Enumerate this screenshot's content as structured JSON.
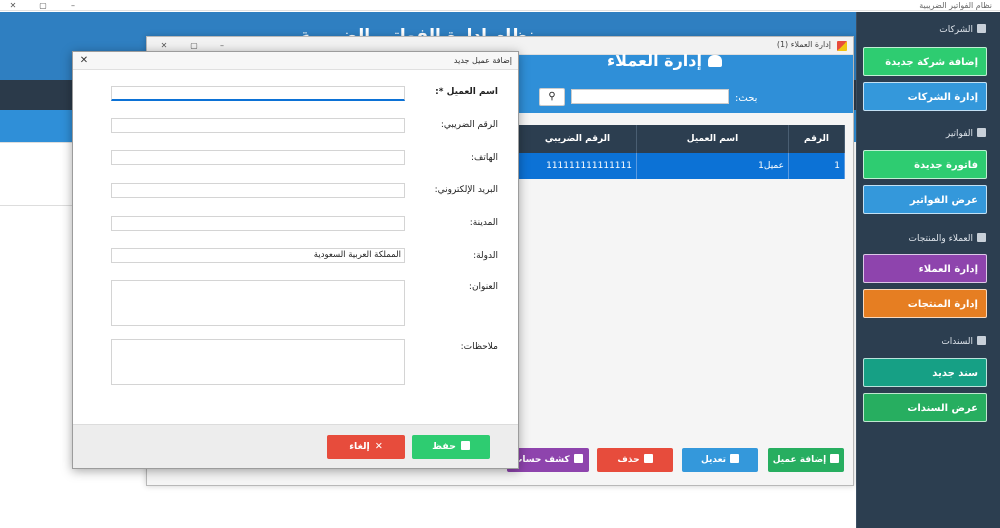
{
  "app": {
    "title": "نظام الفواتير الضريبية",
    "header_title": "نظام إدارة الفواتير الضريبية"
  },
  "sidebar": {
    "sections": [
      {
        "label": "الشركات",
        "icon": "building-icon"
      },
      {
        "label": "الفواتير",
        "icon": "document-icon"
      },
      {
        "label": "العملاء والمنتجات",
        "icon": "users-icon"
      },
      {
        "label": "السندات",
        "icon": "receipt-icon"
      }
    ],
    "buttons": [
      {
        "label": "إضافة شركة جديدة",
        "color": "#2ecc71"
      },
      {
        "label": "إدارة الشركات",
        "color": "#3498db"
      },
      {
        "label": "فاتورة جديدة",
        "color": "#2ecc71"
      },
      {
        "label": "عرض الفواتير",
        "color": "#3498db"
      },
      {
        "label": "إدارة العملاء",
        "color": "#8e44ad"
      },
      {
        "label": "إدارة المنتجات",
        "color": "#e67e22"
      },
      {
        "label": "سند جديد",
        "color": "#16a085"
      },
      {
        "label": "عرض السندات",
        "color": "#27ae60"
      }
    ]
  },
  "customers_window": {
    "title": "إدارة العملاء (1)",
    "header_title": "إدارة العملاء",
    "search_label": "بحث:",
    "search_value": "",
    "table": {
      "columns": [
        "الرقم",
        "اسم العميل",
        "الرقم الضريبي"
      ],
      "rows": [
        [
          "1",
          "عميل1",
          "111111111111111"
        ]
      ]
    },
    "actions": [
      {
        "label": "إضافة عميل",
        "color": "#27ae60"
      },
      {
        "label": "تعديل",
        "color": "#3498db"
      },
      {
        "label": "حذف",
        "color": "#e74c3c"
      },
      {
        "label": "كشف حساب",
        "color": "#8e44ad"
      }
    ]
  },
  "dialog": {
    "title": "إضافة عميل جديد",
    "fields": [
      {
        "label": "اسم العميل *:",
        "value": ""
      },
      {
        "label": "الرقم الضريبي:",
        "value": ""
      },
      {
        "label": "الهاتف:",
        "value": ""
      },
      {
        "label": "البريد الإلكتروني:",
        "value": ""
      },
      {
        "label": "المدينة:",
        "value": ""
      },
      {
        "label": "الدولة:",
        "value": "المملكة العربية السعودية"
      },
      {
        "label": "العنوان:",
        "value": ""
      },
      {
        "label": "ملاحظات:",
        "value": ""
      }
    ],
    "save_label": "حفظ",
    "cancel_label": "إلغاء",
    "save_color": "#2ecc71",
    "cancel_color": "#e74c3c"
  }
}
